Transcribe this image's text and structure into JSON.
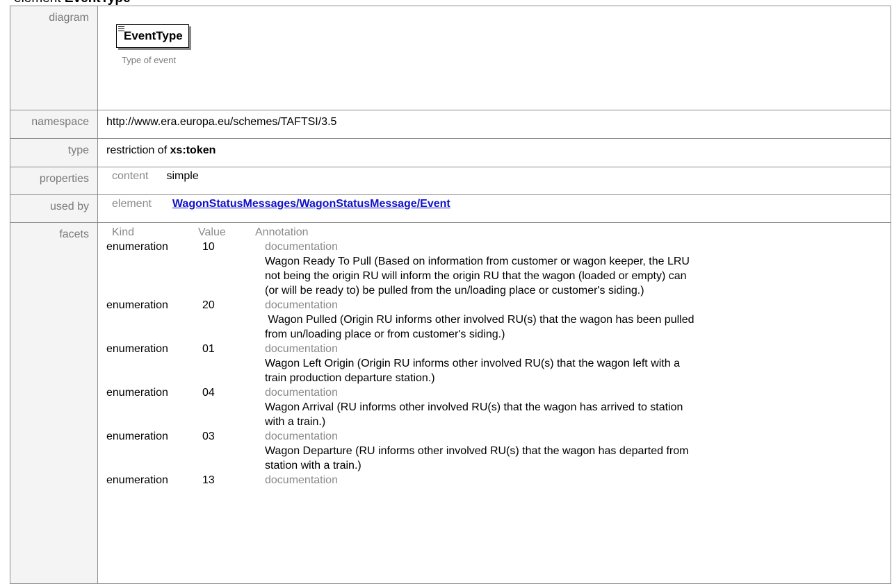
{
  "heading": {
    "prefix": "element",
    "name": "EventType"
  },
  "rows": {
    "diagram": {
      "label": "diagram",
      "box_name": "EventType",
      "caption": "Type of event"
    },
    "namespace": {
      "label": "namespace",
      "value": "http://www.era.europa.eu/schemes/TAFTSI/3.5"
    },
    "type": {
      "label": "type",
      "prefix": "restriction of",
      "value": "xs:token"
    },
    "properties": {
      "label": "properties",
      "key": "content",
      "value": "simple"
    },
    "used_by": {
      "label": "used by",
      "key": "element",
      "link": "WagonStatusMessages/WagonStatusMessage/Event"
    },
    "facets": {
      "label": "facets",
      "headers": {
        "kind": "Kind",
        "value": "Value",
        "annotation": "Annotation"
      },
      "doc_label": "documentation",
      "items": [
        {
          "kind": "enumeration",
          "value": "10",
          "doc_lines": [
            "Wagon Ready To Pull (Based on information from customer or wagon keeper, the LRU",
            "not being the origin RU will inform the origin RU that the wagon (loaded or empty) can",
            "(or will be ready to) be pulled from the un/loading place or customer's siding.)"
          ]
        },
        {
          "kind": "enumeration",
          "value": "20",
          "doc_lines": [
            " Wagon Pulled (Origin RU informs other involved RU(s) that the wagon has been pulled",
            "from un/loading place or from customer's siding.)"
          ]
        },
        {
          "kind": "enumeration",
          "value": "01",
          "doc_lines": [
            "Wagon Left Origin (Origin RU informs other involved RU(s) that the wagon left with a",
            "train production departure station.)"
          ]
        },
        {
          "kind": "enumeration",
          "value": "04",
          "doc_lines": [
            "Wagon Arrival (RU informs other involved RU(s) that the wagon has arrived to station",
            "with a train.)"
          ]
        },
        {
          "kind": "enumeration",
          "value": "03",
          "doc_lines": [
            "Wagon Departure (RU informs other involved RU(s) that the wagon has departed from",
            "station with a train.)"
          ]
        },
        {
          "kind": "enumeration",
          "value": "13",
          "doc_lines": []
        }
      ]
    }
  }
}
